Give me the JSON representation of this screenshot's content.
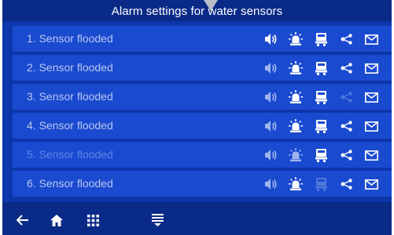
{
  "header": {
    "title": "Alarm settings for water sensors"
  },
  "rows": [
    {
      "label": "1. Sensor flooded",
      "states": [
        "on",
        "on",
        "on",
        "on",
        "on"
      ]
    },
    {
      "label": "2. Sensor flooded",
      "states": [
        "half",
        "on",
        "on",
        "on",
        "on"
      ]
    },
    {
      "label": "3. Sensor flooded",
      "states": [
        "half",
        "on",
        "on",
        "off",
        "on"
      ]
    },
    {
      "label": "4. Sensor flooded",
      "states": [
        "half",
        "on",
        "on",
        "on",
        "on"
      ]
    },
    {
      "label": "5. Sensor flooded",
      "states": [
        "half",
        "half",
        "on",
        "on",
        "on"
      ]
    },
    {
      "label": "6. Sensor flooded",
      "states": [
        "half",
        "on",
        "off",
        "on",
        "on"
      ]
    }
  ],
  "columns": [
    "speaker-icon",
    "siren-icon",
    "pager-icon",
    "share-icon",
    "mail-icon"
  ],
  "nav": [
    "back-arrow-icon",
    "home-icon",
    "grid-menu-icon",
    "list-icon"
  ],
  "colors": {
    "background": "#0d36ab",
    "row": "#1a4ad0",
    "bar": "#0a2a88"
  }
}
